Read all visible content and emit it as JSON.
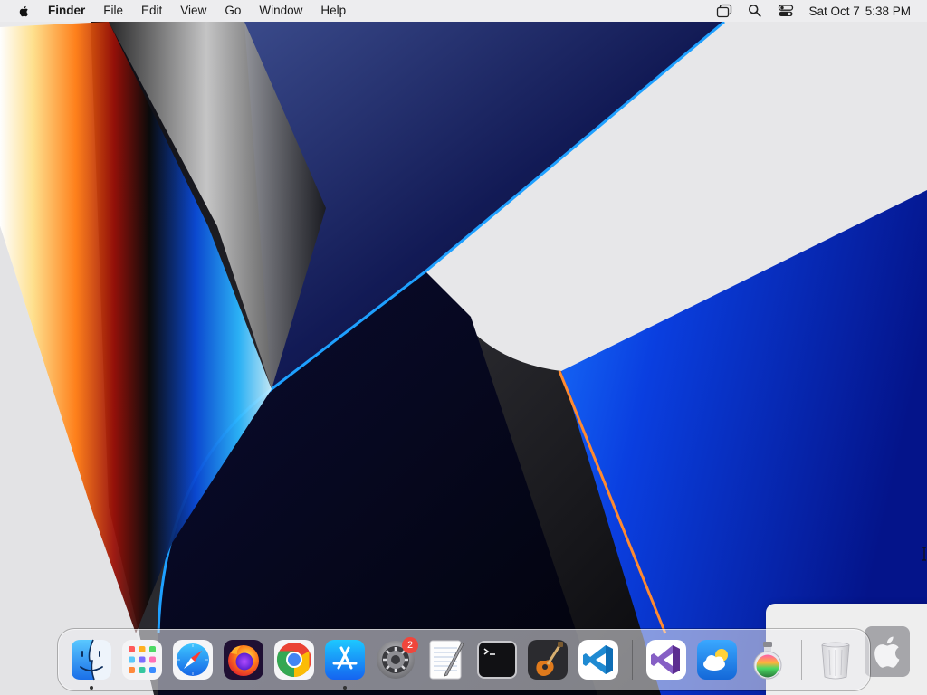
{
  "menubar": {
    "apple_icon": "apple-logo-icon",
    "app_name": "Finder",
    "menus": [
      "File",
      "Edit",
      "View",
      "Go",
      "Window",
      "Help"
    ],
    "status_icons": [
      "screen-mirroring-icon",
      "spotlight-search-icon",
      "control-center-icon"
    ],
    "clock": {
      "date": "Sat Oct 7",
      "time": "5:38 PM"
    }
  },
  "dock": {
    "apps": [
      {
        "name": "Finder",
        "icon": "finder-icon",
        "running": true
      },
      {
        "name": "Launchpad",
        "icon": "launchpad-icon",
        "running": false
      },
      {
        "name": "Safari",
        "icon": "safari-icon",
        "running": false
      },
      {
        "name": "Firefox",
        "icon": "firefox-icon",
        "running": false
      },
      {
        "name": "Google Chrome",
        "icon": "chrome-icon",
        "running": false
      },
      {
        "name": "App Store",
        "icon": "app-store-icon",
        "running": true
      },
      {
        "name": "System Settings",
        "icon": "system-settings-icon",
        "running": false,
        "badge": "2"
      },
      {
        "name": "TextEdit",
        "icon": "textedit-icon",
        "running": false
      },
      {
        "name": "Terminal",
        "icon": "terminal-icon",
        "running": false
      },
      {
        "name": "GarageBand",
        "icon": "garageband-icon",
        "running": false
      },
      {
        "name": "Visual Studio Code",
        "icon": "vscode-icon",
        "running": false
      }
    ],
    "recent_apps": [
      {
        "name": "Visual Studio",
        "icon": "visual-studio-icon"
      },
      {
        "name": "Weather",
        "icon": "weather-icon"
      },
      {
        "name": "Potion",
        "icon": "potion-icon"
      }
    ],
    "trash": {
      "name": "Trash",
      "icon": "trash-icon"
    },
    "badge_color": "#f0463c"
  },
  "colors": {
    "menubar_bg": "#ececee",
    "wallpaper_blue": "#0a2fd0",
    "wallpaper_dark": "#05060f",
    "wallpaper_light": "#e9e9eb"
  }
}
